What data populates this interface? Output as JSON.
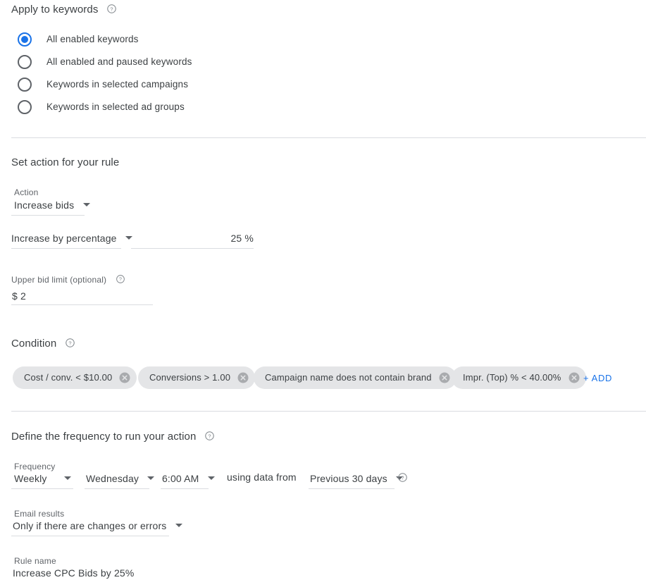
{
  "apply_section": {
    "heading": "Apply to keywords",
    "help_icon": "help-circle-icon",
    "options": [
      {
        "label": "All enabled keywords",
        "selected": true
      },
      {
        "label": "All enabled and paused keywords",
        "selected": false
      },
      {
        "label": "Keywords in selected campaigns",
        "selected": false
      },
      {
        "label": "Keywords in selected ad groups",
        "selected": false
      }
    ]
  },
  "action_section": {
    "heading": "Set action for your rule",
    "action_label": "Action",
    "action_value": "Increase bids",
    "adjust_type_value": "Increase by percentage",
    "amount_value": "25 %",
    "upper_bid_label": "Upper bid limit (optional)",
    "upper_bid_help_icon": "help-circle-icon",
    "upper_bid_value": "$ 2"
  },
  "condition_section": {
    "heading": "Condition",
    "help_icon": "help-circle-icon",
    "chips": [
      {
        "label": "Cost / conv. < $10.00",
        "remove_icon": "remove-circle-icon"
      },
      {
        "label": "Conversions > 1.00",
        "remove_icon": "remove-circle-icon"
      },
      {
        "label": "Campaign name does not contain brand",
        "remove_icon": "remove-circle-icon"
      },
      {
        "label": "Impr. (Top) % < 40.00%",
        "remove_icon": "remove-circle-icon"
      }
    ],
    "add_label": "+ ADD"
  },
  "frequency_section": {
    "heading": "Define the frequency to run your action",
    "help_icon": "help-circle-icon",
    "frequency_label": "Frequency",
    "frequency_value": "Weekly",
    "day_value": "Wednesday",
    "time_value": "6:00 AM",
    "using_data_from_text": "using data from",
    "data_range_value": "Previous 30 days",
    "data_range_help_icon": "help-circle-icon",
    "email_label": "Email results",
    "email_value": "Only if there are changes or errors",
    "rule_name_label": "Rule name",
    "rule_name_value": "Increase CPC Bids by 25%"
  },
  "colors": {
    "accent": "#1a73e8",
    "text": "#3c4043",
    "muted": "#5f6368",
    "divider": "#dadce0",
    "chip_bg": "#e4e5e7"
  }
}
